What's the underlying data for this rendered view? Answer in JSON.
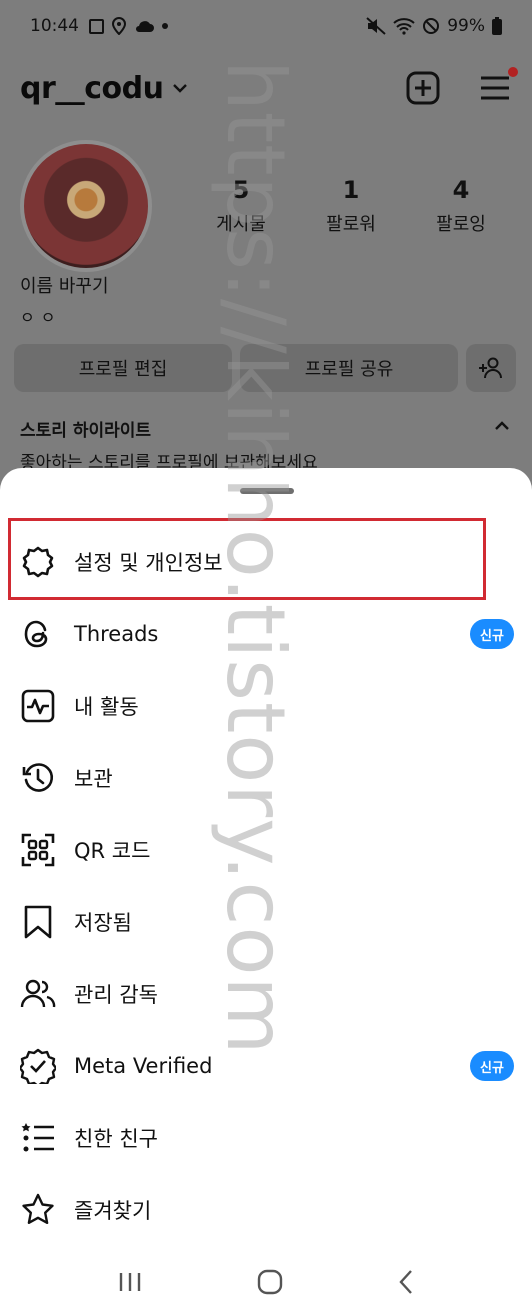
{
  "status_bar": {
    "time": "10:44",
    "battery": "99%"
  },
  "profile": {
    "username": "qr__codu",
    "display_name": "이름 바꾸기",
    "bio": "ㅇㅇ",
    "stats": [
      {
        "value": "5",
        "label": "게시물"
      },
      {
        "value": "1",
        "label": "팔로워"
      },
      {
        "value": "4",
        "label": "팔로잉"
      }
    ],
    "buttons": {
      "edit": "프로필 편집",
      "share": "프로필 공유"
    },
    "highlights": {
      "title": "스토리 하이라이트",
      "description": "좋아하는 스토리를 프로필에 보관해보세요"
    }
  },
  "menu": {
    "items": [
      {
        "label": "설정 및 개인정보",
        "icon": "gear-icon"
      },
      {
        "label": "Threads",
        "icon": "threads-icon",
        "badge": "신규"
      },
      {
        "label": "내 활동",
        "icon": "activity-icon"
      },
      {
        "label": "보관",
        "icon": "archive-icon"
      },
      {
        "label": "QR 코드",
        "icon": "qr-icon"
      },
      {
        "label": "저장됨",
        "icon": "bookmark-icon"
      },
      {
        "label": "관리 감독",
        "icon": "supervision-icon"
      },
      {
        "label": "Meta Verified",
        "icon": "verified-icon",
        "badge": "신규"
      },
      {
        "label": "친한 친구",
        "icon": "close-friends-icon"
      },
      {
        "label": "즐겨찾기",
        "icon": "star-icon"
      }
    ]
  },
  "watermark": "https://kihho.tistory.com",
  "colors": {
    "highlight_border": "#d12a32",
    "badge_blue": "#1a8cff",
    "notification_dot": "#b22222"
  }
}
